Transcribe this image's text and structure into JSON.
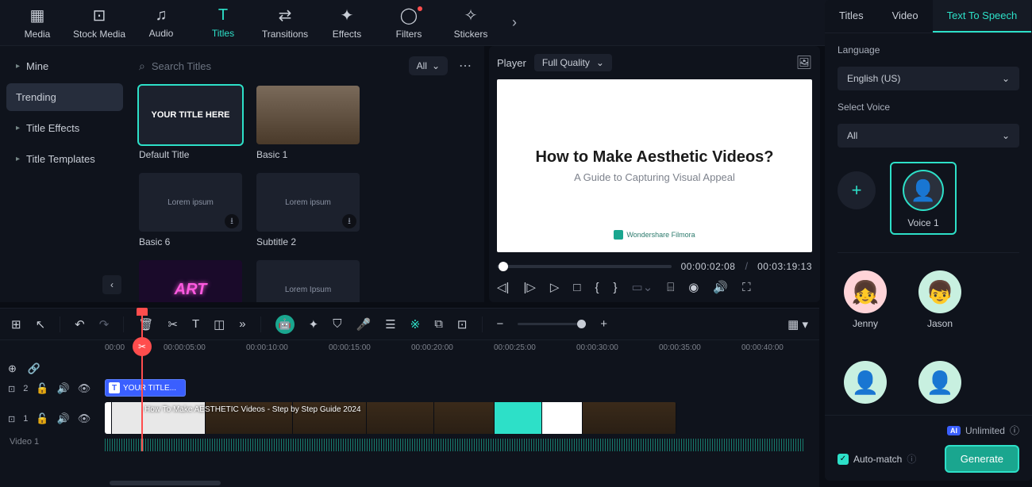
{
  "toolbar": {
    "items": [
      {
        "label": "Media"
      },
      {
        "label": "Stock Media"
      },
      {
        "label": "Audio"
      },
      {
        "label": "Titles"
      },
      {
        "label": "Transitions"
      },
      {
        "label": "Effects"
      },
      {
        "label": "Filters"
      },
      {
        "label": "Stickers"
      }
    ]
  },
  "sidebar": {
    "items": [
      {
        "label": "Mine"
      },
      {
        "label": "Trending"
      },
      {
        "label": "Title Effects"
      },
      {
        "label": "Title Templates"
      }
    ]
  },
  "browser": {
    "search_placeholder": "Search Titles",
    "filter": "All",
    "cards": [
      {
        "thumb_text": "YOUR TITLE HERE",
        "label": "Default Title"
      },
      {
        "thumb_text": "",
        "label": "Basic 1"
      },
      {
        "thumb_text": "Lorem ipsum",
        "label": "Basic 6"
      },
      {
        "thumb_text": "Lorem ipsum",
        "label": "Subtitle 2"
      },
      {
        "thumb_text": "ART",
        "label": ""
      },
      {
        "thumb_text": "Lorem Ipsum",
        "label": ""
      }
    ]
  },
  "player": {
    "label": "Player",
    "quality": "Full Quality",
    "title": "How to Make Aesthetic Videos?",
    "subtitle": "A Guide to Capturing Visual Appeal",
    "watermark": "Wondershare Filmora",
    "time_current": "00:00:02:08",
    "time_total": "00:03:19:13"
  },
  "inspector": {
    "tabs": [
      "Titles",
      "Video",
      "Text To Speech"
    ],
    "language_label": "Language",
    "language_value": "English (US)",
    "voice_label": "Select Voice",
    "voice_filter": "All",
    "selected_voice": "Voice 1",
    "voices": [
      "Jenny",
      "Jason"
    ],
    "unlimited": "Unlimited",
    "auto_match": "Auto-match",
    "generate": "Generate"
  },
  "timeline": {
    "ticks": [
      "00:00",
      "00:00:05:00",
      "00:00:10:00",
      "00:00:15:00",
      "00:00:20:00",
      "00:00:25:00",
      "00:00:30:00",
      "00:00:35:00",
      "00:00:40:00"
    ],
    "title_clip": "YOUR TITLE...",
    "video_clip_text": "How To Make AESTHETIC Videos - Step by Step Guide 2024",
    "track2_badge": "2",
    "track1_badge": "1",
    "video_label": "Video 1"
  }
}
